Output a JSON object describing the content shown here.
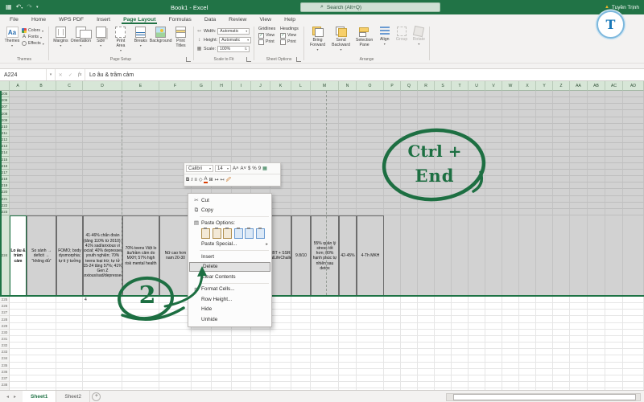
{
  "title_bar": {
    "title": "Book1 - Excel",
    "search_placeholder": "Search (Alt+Q)",
    "user": "Tuyền Trịnh",
    "brand_initial": "T"
  },
  "ribbon": {
    "tabs": [
      "File",
      "Home",
      "WPS PDF",
      "Insert",
      "Page Layout",
      "Formulas",
      "Data",
      "Review",
      "View",
      "Help"
    ],
    "active_tab": "Page Layout",
    "groups": {
      "themes": {
        "label": "Themes",
        "big_button": "Themes",
        "items": [
          "Colors",
          "Fonts",
          "Effects"
        ]
      },
      "page_setup": {
        "label": "Page Setup",
        "buttons": [
          "Margins",
          "Orientation",
          "Size",
          "Print\nArea",
          "Breaks",
          "Background",
          "Print\nTitles"
        ]
      },
      "scale_to_fit": {
        "label": "Scale to Fit",
        "rows": [
          {
            "name": "Width:",
            "value": "Automatic"
          },
          {
            "name": "Height:",
            "value": "Automatic"
          },
          {
            "name": "Scale:",
            "value": "100%"
          }
        ]
      },
      "sheet_options": {
        "label": "Sheet Options",
        "columns": [
          {
            "title": "Gridlines",
            "options": [
              {
                "label": "View",
                "checked": true
              },
              {
                "label": "Print",
                "checked": false
              }
            ]
          },
          {
            "title": "Headings",
            "options": [
              {
                "label": "View",
                "checked": true
              },
              {
                "label": "Print",
                "checked": false
              }
            ]
          }
        ]
      },
      "arrange": {
        "label": "Arrange",
        "buttons": [
          "Bring\nForward",
          "Send\nBackward",
          "Selection\nPane",
          "Align",
          "Group",
          "Rotate"
        ]
      }
    }
  },
  "formula_bar": {
    "name_box": "A224",
    "formula": "Lo âu & trầm cảm"
  },
  "grid": {
    "columns": [
      "A",
      "B",
      "C",
      "D",
      "E",
      "F",
      "G",
      "H",
      "I",
      "J",
      "K",
      "L",
      "M",
      "N",
      "O",
      "P",
      "Q",
      "R",
      "S",
      "T",
      "U",
      "V",
      "W",
      "X",
      "Y",
      "Z",
      "AA",
      "AB",
      "AC",
      "AD"
    ],
    "rows_above": {
      "from": 205,
      "to": 223
    },
    "selected_row": "224",
    "rows_below": {
      "from": 225,
      "to": 239
    },
    "row224_cells": {
      "A": "Lo âu & trầm cảm",
      "B": "So sánh → deficit → “không đủ”",
      "C": "FOMO; body dysmorphia; tự ti ý tưởng",
      "D": "41-46% chẩn đoán (tăng 110% từ 2010); 41% sad/anxious vì social; 40% depressed youth nghiện; 70% teens loại trừ; tự tử 15-24 tăng 57%; 41% Gen Z anxious/sad/depressed",
      "E": "70% teens Việt lo âu/trầm cảm do MXH; 57% high risk mental health",
      "F": "Nữ cao hơn nam 20-30",
      "K": "CBT + SSRI; #RealLifeChallenge",
      "L": "9.8/10",
      "M": "55% quản lý stress tốt hơn; 80% hạnh phúc tự nhiên sau detox",
      "N": "42-45%",
      "O": "4-Th MKH"
    },
    "cell_D225": "4"
  },
  "mini_toolbar": {
    "font_name": "Calibri",
    "font_size": "14"
  },
  "context_menu": {
    "cut": "Cut",
    "copy": "Copy",
    "paste_options": "Paste Options:",
    "paste_special": "Paste Special...",
    "insert": "Insert",
    "delete": "Delete",
    "clear_contents": "Clear Contents",
    "format_cells": "Format Cells...",
    "row_height": "Row Height...",
    "hide": "Hide",
    "unhide": "Unhide",
    "highlighted": "delete"
  },
  "sheet_tabs": {
    "tabs": [
      "Sheet1",
      "Sheet2"
    ],
    "active": "Sheet1"
  },
  "annotations": {
    "shortcut_line1": "Ctrl +",
    "shortcut_line2": "End",
    "step_number": "2"
  },
  "colors": {
    "excel_green": "#217346",
    "annotation_green": "#1d6f42",
    "selection_gray": "#d2d2d2"
  }
}
